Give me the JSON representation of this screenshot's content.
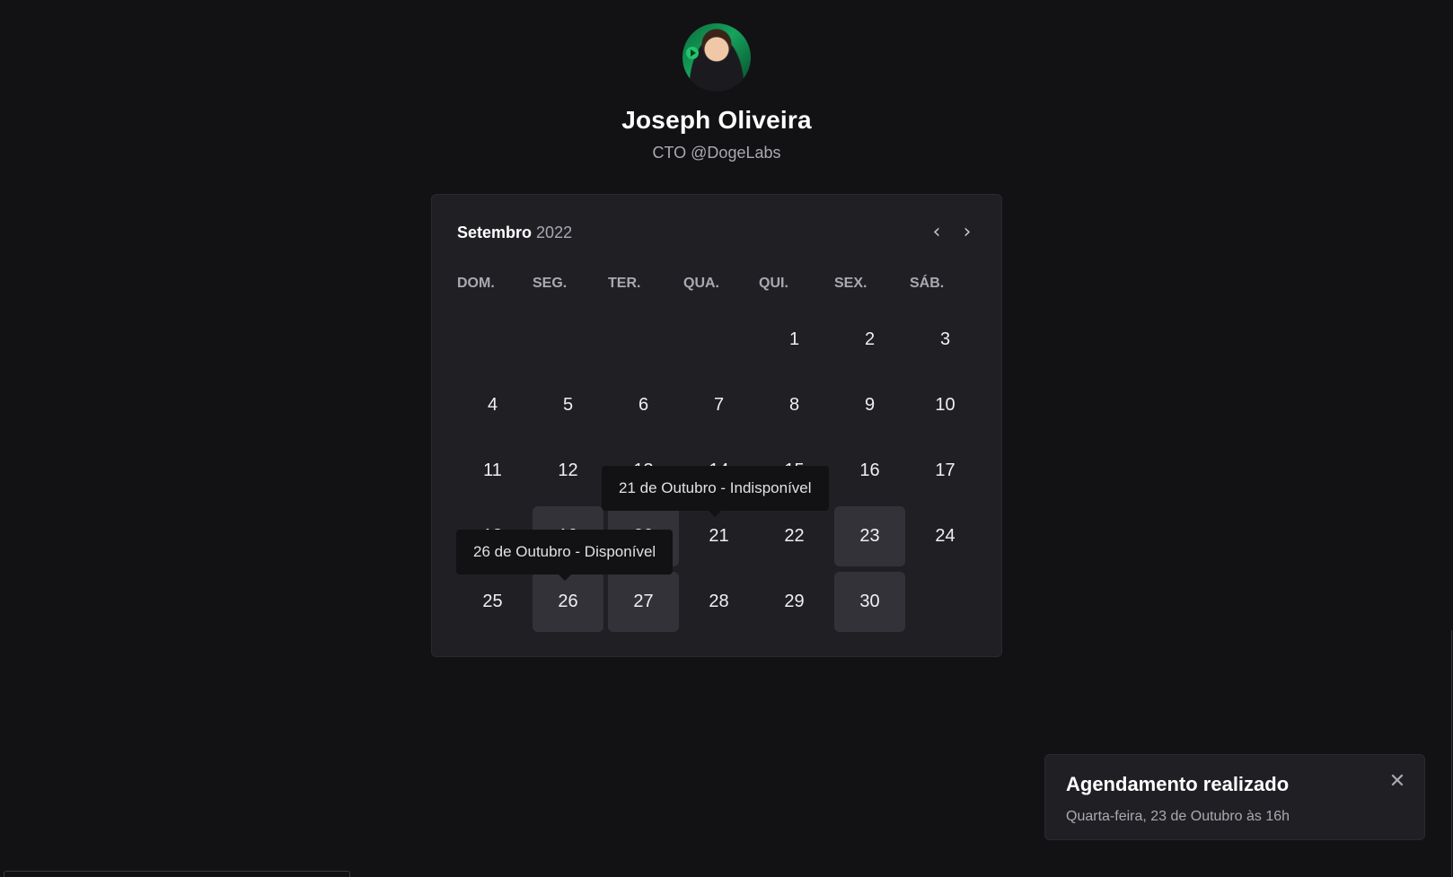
{
  "profile": {
    "name": "Joseph Oliveira",
    "role": "CTO @DogeLabs"
  },
  "calendar": {
    "month": "Setembro",
    "year": "2022",
    "prev_icon": "chevron-left-icon",
    "next_icon": "chevron-right-icon",
    "weekdays": [
      "DOM.",
      "SEG.",
      "TER.",
      "QUA.",
      "QUI.",
      "SEX.",
      "SÁB."
    ],
    "weeks": [
      [
        "",
        "",
        "",
        "",
        "1",
        "2",
        "3"
      ],
      [
        "4",
        "5",
        "6",
        "7",
        "8",
        "9",
        "10"
      ],
      [
        "11",
        "12",
        "13",
        "14",
        "15",
        "16",
        "17"
      ],
      [
        "18",
        "19",
        "20",
        "21",
        "22",
        "23",
        "24"
      ],
      [
        "25",
        "26",
        "27",
        "28",
        "29",
        "30",
        ""
      ]
    ],
    "available_days": [
      "19",
      "20",
      "23",
      "26",
      "27",
      "30"
    ],
    "tooltips": {
      "day21": "21 de Outubro - Indisponível",
      "day26": "26 de Outubro - Disponível"
    }
  },
  "toast": {
    "title": "Agendamento realizado",
    "description": "Quarta-feira, 23 de Outubro às 16h",
    "close_icon": "close-icon"
  },
  "colors": {
    "background": "#121214",
    "surface": "#202024",
    "available_day": "#323238",
    "text_muted": "#a9a9b2"
  }
}
